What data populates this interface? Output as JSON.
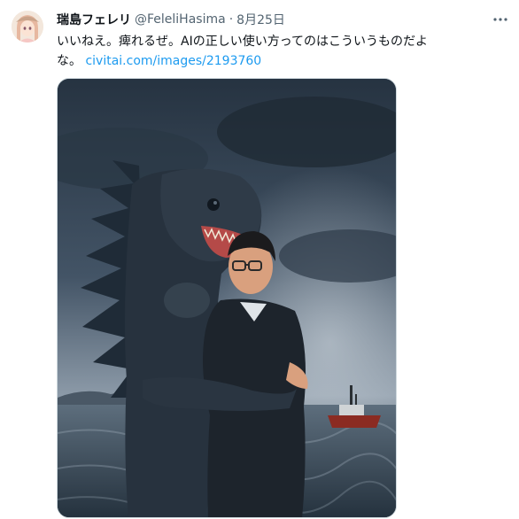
{
  "tweet": {
    "display_name": "瑞島フェレリ",
    "handle": "@FeleliHasima",
    "separator": "·",
    "date": "8月25日",
    "text_line1": "いいねえ。痺れるぜ。AIの正しい使い方ってのはこういうものだよ",
    "text_line2_prefix": "な。",
    "link_text": "civitai.com/images/2193760",
    "image_alt": "image"
  },
  "icons": {
    "more": "more-horizontal-icon",
    "avatar": "avatar-anime-portrait"
  },
  "colors": {
    "link": "#1d9bf0",
    "text": "#0f1419",
    "secondary": "#536471",
    "media_border": "#cfd9de"
  }
}
